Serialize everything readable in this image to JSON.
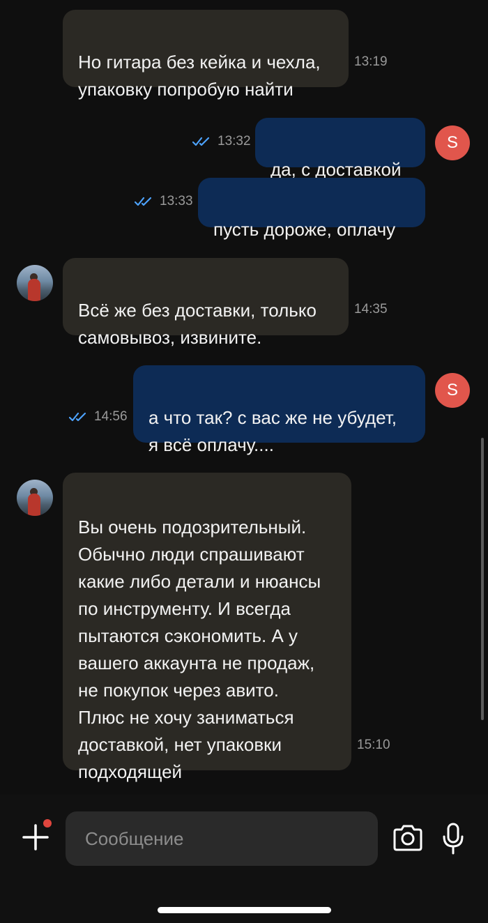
{
  "messages": [
    {
      "id": "m1",
      "text": "Но гитара без кейка и чехла,\nупаковку попробую найти",
      "time": "13:19"
    },
    {
      "id": "m2",
      "text": "да, с доставкой",
      "time": "13:32",
      "avatar_letter": "S"
    },
    {
      "id": "m3",
      "text": "пусть дороже, оплачу",
      "time": "13:33"
    },
    {
      "id": "m4",
      "text": "Всё же без доставки, только\nсамовывоз, извините.",
      "time": "14:35"
    },
    {
      "id": "m5",
      "text": "а что так? с вас же не убудет,\nя всё оплачу....",
      "time": "14:56",
      "avatar_letter": "S"
    },
    {
      "id": "m6",
      "text": "Вы очень подозрительный.\nОбычно люди спрашивают\nкакие либо детали и нюансы\nпо инструменту. И всегда\nпытаются сэкономить. А у\nвашего аккаунта не продаж,\nне покупок через авито.\nПлюс не хочу заниматься\nдоставкой, нет упаковки\nподходящей",
      "time": "15:10"
    }
  ],
  "composer": {
    "placeholder": "Сообщение"
  },
  "icons": {
    "attach": "plus-icon",
    "camera": "camera-icon",
    "mic": "microphone-icon",
    "read_status": "double-check-icon"
  },
  "colors": {
    "incoming_bubble": "#2b2924",
    "outgoing_bubble": "#0d2b55",
    "read_checks": "#4da3ff",
    "avatar_s": "#e1564c",
    "unread_dot": "#e0463e"
  }
}
